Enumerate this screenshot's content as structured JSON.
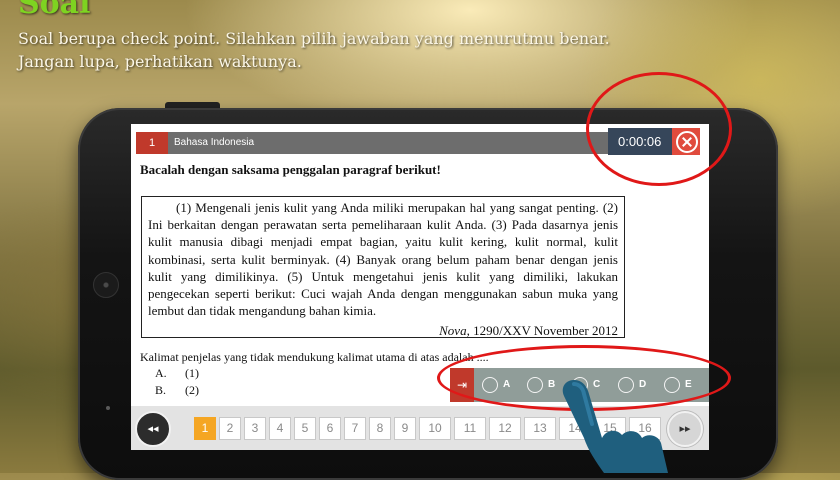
{
  "header": {
    "title": "Soal",
    "subtitle_line1": "Soal berupa check point. Silahkan pilih jawaban yang menurutmu benar.",
    "subtitle_line2": "Jangan lupa, perhatikan waktunya."
  },
  "topbar": {
    "question_number": "1",
    "subject": "Bahasa Indonesia",
    "timer": "0:00:06",
    "close_icon": "close-circle-icon"
  },
  "content": {
    "instruction": "Bacalah dengan saksama penggalan paragraf berikut!",
    "passage": "(1) Mengenali jenis kulit yang Anda miliki merupakan hal yang sangat penting. (2) Ini berkaitan dengan perawatan serta pemeliharaan kulit Anda. (3) Pada dasarnya jenis kulit manusia dibagi menjadi empat bagian, yaitu kulit kering, kulit normal, kulit kombinasi, serta kulit berminyak. (4) Banyak orang belum paham benar dengan jenis kulit yang dimilikinya. (5) Untuk mengetahui jenis kulit yang dimiliki, lakukan pengecekan seperti berikut: Cuci wajah Anda dengan menggunakan sabun muka yang lembut dan tidak mengandung bahan kimia.",
    "source_italic": "Nova,",
    "source_rest": " 1290/XXV November 2012",
    "question": "Kalimat penjelas yang tidak mendukung kalimat utama di atas adalah ....",
    "options": [
      {
        "letter": "A.",
        "text": "(1)"
      },
      {
        "letter": "B.",
        "text": "(2)"
      }
    ]
  },
  "answer_bar": {
    "skip_icon": "⇥",
    "choices": [
      "A",
      "B",
      "C",
      "D",
      "E"
    ]
  },
  "pager": {
    "prev_label": "◂◂",
    "next_label": "▸▸",
    "pages": [
      "1",
      "2",
      "3",
      "4",
      "5",
      "6",
      "7",
      "8",
      "9",
      "10",
      "11",
      "12",
      "13",
      "14",
      "15",
      "16"
    ],
    "active_page": "1"
  },
  "colors": {
    "title_green": "#7ed321",
    "accent_red": "#c0392b",
    "timer_bg": "#36465a",
    "active_page": "#f5a623",
    "annotation_red": "#e01818"
  }
}
